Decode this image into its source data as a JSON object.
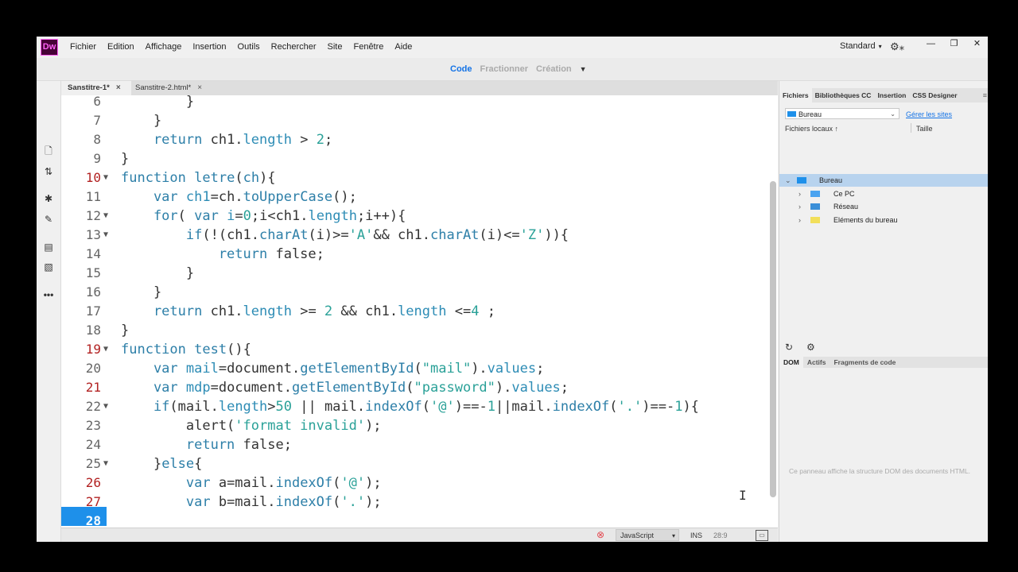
{
  "app": {
    "logo": "Dw",
    "menus": [
      "Fichier",
      "Edition",
      "Affichage",
      "Insertion",
      "Outils",
      "Rechercher",
      "Site",
      "Fenêtre",
      "Aide"
    ],
    "workspace": "Standard",
    "window_controls": {
      "minimize": "—",
      "restore": "❐",
      "close": "✕"
    }
  },
  "viewbar": {
    "views": [
      "Code",
      "Fractionner",
      "Création"
    ],
    "active": "Code"
  },
  "tabs": [
    {
      "label": "Sanstitre-1*",
      "close": "×",
      "active": true
    },
    {
      "label": "Sanstitre-2.html*",
      "close": "×",
      "active": false
    }
  ],
  "editor": {
    "lines": [
      {
        "n": "6",
        "modified": false,
        "fold": false,
        "tokens": [
          [
            "",
            "        }"
          ]
        ]
      },
      {
        "n": "7",
        "modified": false,
        "fold": false,
        "tokens": [
          [
            "",
            "    }"
          ]
        ]
      },
      {
        "n": "8",
        "modified": false,
        "fold": false,
        "tokens": [
          [
            "kw",
            "    return"
          ],
          [
            "",
            " ch1."
          ],
          [
            "prop",
            "length"
          ],
          [
            "",
            " > "
          ],
          [
            "num",
            "2"
          ],
          [
            "",
            ";"
          ]
        ]
      },
      {
        "n": "9",
        "modified": false,
        "fold": false,
        "tokens": [
          [
            "",
            "}"
          ]
        ]
      },
      {
        "n": "10",
        "modified": true,
        "fold": true,
        "tokens": [
          [
            "kw",
            "function"
          ],
          [
            "",
            " "
          ],
          [
            "fn",
            "letre"
          ],
          [
            "",
            "("
          ],
          [
            "kw",
            "ch"
          ],
          [
            "",
            "){"
          ]
        ]
      },
      {
        "n": "11",
        "modified": false,
        "fold": false,
        "tokens": [
          [
            "kw",
            "    var"
          ],
          [
            "",
            " "
          ],
          [
            "prop",
            "ch1"
          ],
          [
            "",
            "=ch."
          ],
          [
            "fn",
            "toUpperCase"
          ],
          [
            "",
            "();"
          ]
        ]
      },
      {
        "n": "12",
        "modified": false,
        "fold": true,
        "tokens": [
          [
            "kw",
            "    for"
          ],
          [
            "",
            "( "
          ],
          [
            "kw",
            "var"
          ],
          [
            "",
            " "
          ],
          [
            "prop",
            "i"
          ],
          [
            "",
            "="
          ],
          [
            "num",
            "0"
          ],
          [
            "",
            ";i<ch1."
          ],
          [
            "prop",
            "length"
          ],
          [
            "",
            ";i++){"
          ]
        ]
      },
      {
        "n": "13",
        "modified": false,
        "fold": true,
        "tokens": [
          [
            "kw",
            "        if"
          ],
          [
            "",
            "(!(ch1."
          ],
          [
            "fn",
            "charAt"
          ],
          [
            "",
            "(i)>="
          ],
          [
            "str",
            "'A'"
          ],
          [
            "",
            "&& ch1."
          ],
          [
            "fn",
            "charAt"
          ],
          [
            "",
            "(i)<="
          ],
          [
            "str",
            "'Z'"
          ],
          [
            "",
            ")){"
          ]
        ]
      },
      {
        "n": "14",
        "modified": false,
        "fold": false,
        "tokens": [
          [
            "kw",
            "            return"
          ],
          [
            "",
            " false;"
          ]
        ]
      },
      {
        "n": "15",
        "modified": false,
        "fold": false,
        "tokens": [
          [
            "",
            "        }"
          ]
        ]
      },
      {
        "n": "16",
        "modified": false,
        "fold": false,
        "tokens": [
          [
            "",
            "    }"
          ]
        ]
      },
      {
        "n": "17",
        "modified": false,
        "fold": false,
        "tokens": [
          [
            "kw",
            "    return"
          ],
          [
            "",
            " ch1."
          ],
          [
            "prop",
            "length"
          ],
          [
            "",
            " >= "
          ],
          [
            "num",
            "2"
          ],
          [
            "",
            " && ch1."
          ],
          [
            "prop",
            "length"
          ],
          [
            "",
            " <="
          ],
          [
            "num",
            "4"
          ],
          [
            "",
            " ;"
          ]
        ]
      },
      {
        "n": "18",
        "modified": false,
        "fold": false,
        "tokens": [
          [
            "",
            "}"
          ]
        ]
      },
      {
        "n": "19",
        "modified": true,
        "fold": true,
        "tokens": [
          [
            "kw",
            "function"
          ],
          [
            "",
            " "
          ],
          [
            "fn",
            "test"
          ],
          [
            "",
            "(){"
          ]
        ]
      },
      {
        "n": "20",
        "modified": false,
        "fold": false,
        "tokens": [
          [
            "kw",
            "    var"
          ],
          [
            "",
            " "
          ],
          [
            "prop",
            "mail"
          ],
          [
            "",
            "=document."
          ],
          [
            "fn",
            "getElementById"
          ],
          [
            "",
            "("
          ],
          [
            "str",
            "\"mail\""
          ],
          [
            "",
            ")."
          ],
          [
            "prop",
            "values"
          ],
          [
            "",
            ";"
          ]
        ]
      },
      {
        "n": "21",
        "modified": true,
        "fold": false,
        "tokens": [
          [
            "kw",
            "    var"
          ],
          [
            "",
            " "
          ],
          [
            "prop",
            "mdp"
          ],
          [
            "",
            "=document."
          ],
          [
            "fn",
            "getElementById"
          ],
          [
            "",
            "("
          ],
          [
            "str",
            "\"password\""
          ],
          [
            "",
            ")."
          ],
          [
            "prop",
            "values"
          ],
          [
            "",
            ";"
          ]
        ]
      },
      {
        "n": "22",
        "modified": false,
        "fold": true,
        "tokens": [
          [
            "kw",
            "    if"
          ],
          [
            "",
            "(mail."
          ],
          [
            "prop",
            "length"
          ],
          [
            "",
            ">"
          ],
          [
            "num",
            "50"
          ],
          [
            "",
            " || mail."
          ],
          [
            "fn",
            "indexOf"
          ],
          [
            "",
            "("
          ],
          [
            "str",
            "'@'"
          ],
          [
            "",
            ")==-"
          ],
          [
            "num",
            "1"
          ],
          [
            "",
            "||mail."
          ],
          [
            "fn",
            "indexOf"
          ],
          [
            "",
            "("
          ],
          [
            "str",
            "'.'"
          ],
          [
            "",
            ")==-"
          ],
          [
            "num",
            "1"
          ],
          [
            "",
            "){"
          ]
        ]
      },
      {
        "n": "23",
        "modified": false,
        "fold": false,
        "tokens": [
          [
            "",
            "        alert("
          ],
          [
            "str",
            "'format invalid'"
          ],
          [
            "",
            ");"
          ]
        ]
      },
      {
        "n": "24",
        "modified": false,
        "fold": false,
        "tokens": [
          [
            "kw",
            "        return"
          ],
          [
            "",
            " false;"
          ]
        ]
      },
      {
        "n": "25",
        "modified": false,
        "fold": true,
        "tokens": [
          [
            "",
            "    }"
          ],
          [
            "kw",
            "else"
          ],
          [
            "",
            "{"
          ]
        ]
      },
      {
        "n": "26",
        "modified": true,
        "fold": false,
        "tokens": [
          [
            "kw",
            "        var"
          ],
          [
            "",
            " a=mail."
          ],
          [
            "fn",
            "indexOf"
          ],
          [
            "",
            "("
          ],
          [
            "str",
            "'@'"
          ],
          [
            "",
            ");"
          ]
        ]
      },
      {
        "n": "27",
        "modified": true,
        "fold": false,
        "tokens": [
          [
            "kw",
            "        var"
          ],
          [
            "",
            " b=mail."
          ],
          [
            "fn",
            "indexOf"
          ],
          [
            "",
            "("
          ],
          [
            "str",
            "'.'"
          ],
          [
            "",
            ");"
          ]
        ]
      },
      {
        "n": "28",
        "modified": false,
        "fold": false,
        "current": true,
        "tokens": [
          [
            "",
            ""
          ]
        ]
      }
    ],
    "cursor_glyph": "I"
  },
  "status": {
    "error_icon": "⊗",
    "language": "JavaScript",
    "mode": "INS",
    "position": "28:9"
  },
  "rpanel": {
    "tabs": [
      "Fichiers",
      "Bibliothèques CC",
      "Insertion",
      "CSS Designer"
    ],
    "site": "Bureau",
    "manage_sites": "Gérer les sites",
    "local_files": "Fichiers locaux ↑",
    "size": "Taille",
    "tree": [
      {
        "label": "Bureau",
        "level": 0,
        "expanded": true,
        "selected": true,
        "icon": "monitor-icon"
      },
      {
        "label": "Ce PC",
        "level": 1,
        "expanded": false,
        "selected": false,
        "icon": "computer-icon"
      },
      {
        "label": "Réseau",
        "level": 1,
        "expanded": false,
        "selected": false,
        "icon": "network-icon"
      },
      {
        "label": "Eléments du bureau",
        "level": 1,
        "expanded": false,
        "selected": false,
        "icon": "folder-icon"
      }
    ],
    "bottom_tabs": [
      "DOM",
      "Actifs",
      "Fragments de code"
    ],
    "dom_message": "Ce panneau affiche la structure DOM des documents HTML."
  },
  "colors": {
    "accent": "#1473e6",
    "line_highlight": "#1e90ea",
    "modified_line": "#b22222",
    "keyword": "#2d7fa8",
    "string": "#2aa198"
  }
}
